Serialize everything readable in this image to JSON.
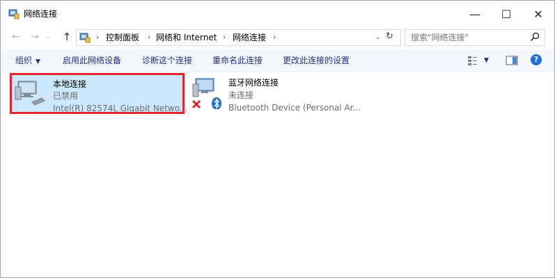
{
  "window": {
    "title": "网络连接",
    "minimize_glyph": "—",
    "maximize_glyph": "☐",
    "close_glyph": "✕"
  },
  "nav": {
    "back_glyph": "←",
    "forward_glyph": "→",
    "recent_glyph": "⌄",
    "up_glyph": "↑",
    "breadcrumb": [
      "控制面板",
      "网络和 Internet",
      "网络连接"
    ],
    "separator": "›",
    "dropdown_glyph": "⌄",
    "refresh_glyph": "↻",
    "search_placeholder": "搜索\"网络连接\""
  },
  "toolbar": {
    "organize": "组织",
    "enable_device": "启用此网络设备",
    "diagnose": "诊断这个连接",
    "rename": "重命名此连接",
    "change_settings": "更改此连接的设置",
    "caret": "▼",
    "help": "?"
  },
  "connections": [
    {
      "name": "本地连接",
      "status": "已禁用",
      "device": "Intel(R) 82574L Gigabit Netwo..."
    },
    {
      "name": "蓝牙网络连接",
      "status": "未连接",
      "device": "Bluetooth Device (Personal Ar..."
    }
  ],
  "colors": {
    "selection_bg": "#cce8ff",
    "selection_border": "#e5232a",
    "command_text": "#1e3287",
    "help_blue": "#1f6fd2"
  },
  "icons": [
    "network-control-panel-icon",
    "search-icon",
    "change-view-icon",
    "preview-pane-icon",
    "help-icon",
    "ethernet-adapter-icon",
    "bluetooth-adapter-icon",
    "red-x-disconnected-icon",
    "bluetooth-badge-icon"
  ]
}
